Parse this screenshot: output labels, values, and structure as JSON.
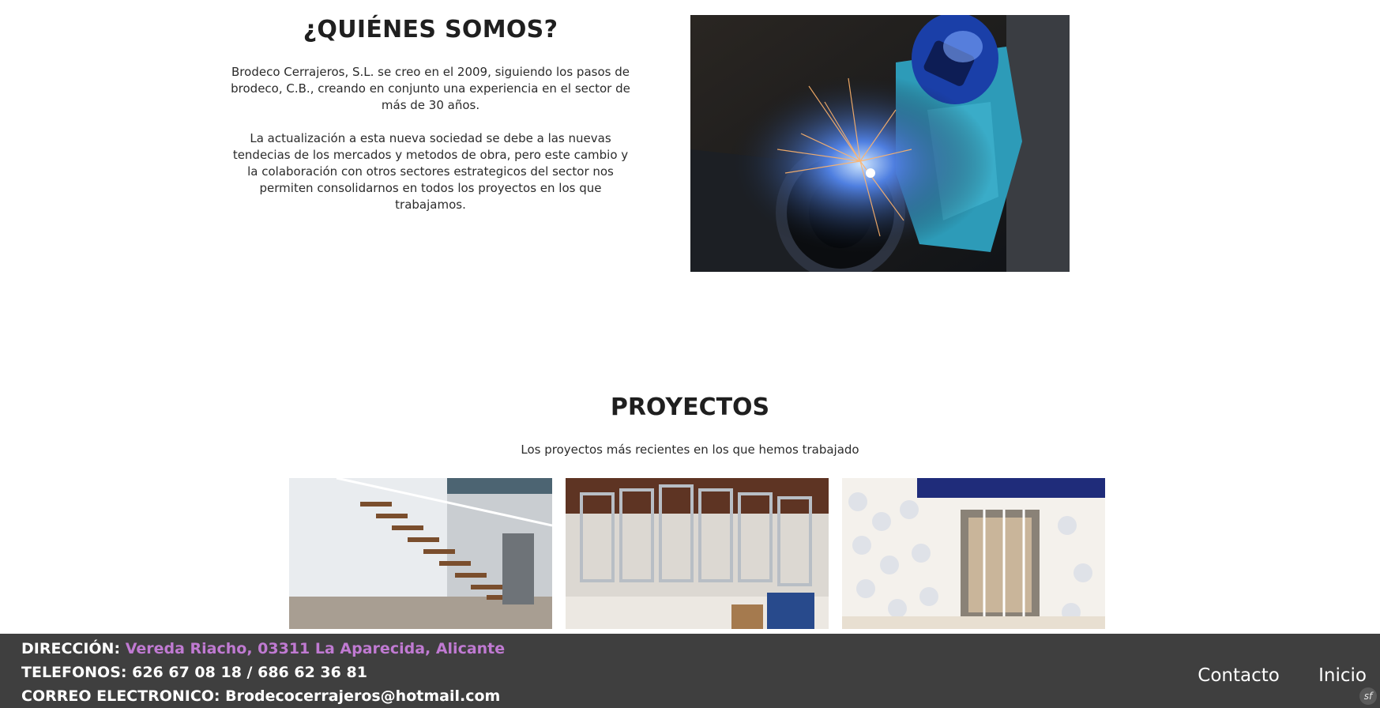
{
  "about": {
    "title": "¿QUIÉNES SOMOS?",
    "paragraph1": "Brodeco Cerrajeros, S.L. se creo en el 2009, siguiendo los pasos de brodeco, C.B., creando en conjunto una experiencia en el sector de más de 30 años.",
    "paragraph2": "La actualización a esta nueva sociedad se debe a las nuevas tendecias de los mercados y metodos de obra, pero este cambio y la colaboración con otros sectores estrategicos del sector nos permiten consolidarnos en todos los proyectos en los que trabajamos."
  },
  "projects": {
    "title": "PROYECTOS",
    "subtitle": "Los proyectos más recientes en los que hemos trabajado"
  },
  "footer": {
    "address_label": "DIRECCIÓN:",
    "address_value": "Vereda Riacho, 03311 La Aparecida, Alicante",
    "phones": "TELEFONOS: 626 67 08 18 / 686 62 36 81",
    "email": "CORREO ELECTRONICO: Brodecocerrajeros@hotmail.com",
    "nav": [
      "Contacto",
      "Inicio"
    ],
    "link_color": "#c07ad2",
    "background_color": "#3f3f3f"
  },
  "badge_icon": "symfony-icon"
}
